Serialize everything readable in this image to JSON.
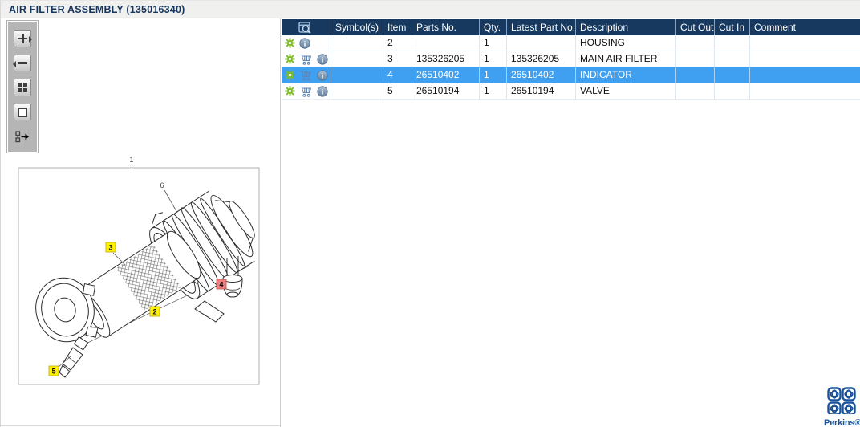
{
  "window": {
    "title": "AIR FILTER ASSEMBLY (135016340)"
  },
  "toolbar": {
    "buttons": [
      {
        "name": "zoom-in"
      },
      {
        "name": "zoom-out"
      },
      {
        "name": "fit-to-window"
      },
      {
        "name": "zoom-window"
      },
      {
        "name": "send-to-parts-list"
      }
    ]
  },
  "diagram": {
    "labels": [
      {
        "text": "1",
        "style": "plain"
      },
      {
        "text": "6",
        "style": "plain"
      },
      {
        "text": "3",
        "style": "yellow"
      },
      {
        "text": "2",
        "style": "yellow"
      },
      {
        "text": "4",
        "style": "red"
      },
      {
        "text": "5",
        "style": "yellow"
      }
    ]
  },
  "table": {
    "columns": [
      {
        "key": "icons",
        "label": ""
      },
      {
        "key": "symbols",
        "label": "Symbol(s)"
      },
      {
        "key": "item",
        "label": "Item"
      },
      {
        "key": "parts_no",
        "label": "Parts No."
      },
      {
        "key": "qty",
        "label": "Qty."
      },
      {
        "key": "latest_part_no",
        "label": "Latest Part No."
      },
      {
        "key": "description",
        "label": "Description"
      },
      {
        "key": "cut_out",
        "label": "Cut Out"
      },
      {
        "key": "cut_in",
        "label": "Cut In"
      },
      {
        "key": "comment",
        "label": "Comment"
      }
    ],
    "rows": [
      {
        "icons": [
          "settings",
          "info"
        ],
        "symbols": "",
        "item": "2",
        "parts_no": "",
        "qty": "1",
        "latest_part_no": "",
        "description": "HOUSING",
        "cut_out": "",
        "cut_in": "",
        "comment": "",
        "selected": false
      },
      {
        "icons": [
          "settings",
          "cart",
          "info"
        ],
        "symbols": "",
        "item": "3",
        "parts_no": "135326205",
        "qty": "1",
        "latest_part_no": "135326205",
        "description": "MAIN AIR FILTER",
        "cut_out": "",
        "cut_in": "",
        "comment": "",
        "selected": false
      },
      {
        "icons": [
          "settings",
          "cart",
          "info"
        ],
        "symbols": "",
        "item": "4",
        "parts_no": "26510402",
        "qty": "1",
        "latest_part_no": "26510402",
        "description": "INDICATOR",
        "cut_out": "",
        "cut_in": "",
        "comment": "",
        "selected": true
      },
      {
        "icons": [
          "settings",
          "cart",
          "info"
        ],
        "symbols": "",
        "item": "5",
        "parts_no": "26510194",
        "qty": "1",
        "latest_part_no": "26510194",
        "description": "VALVE",
        "cut_out": "",
        "cut_in": "",
        "comment": "",
        "selected": false
      }
    ]
  },
  "branding": {
    "logo_text": "Perkins®"
  },
  "colors": {
    "header_bg": "#17395f",
    "selected_row": "#3f9ff0",
    "gear_green": "#7fbc2b",
    "cart_blue": "#5e86b8",
    "info_blue": "#7a96b5",
    "label_yellow": "#fff104",
    "label_red": "#f08080",
    "logo_blue": "#1a539b",
    "title_text": "#17365d"
  }
}
